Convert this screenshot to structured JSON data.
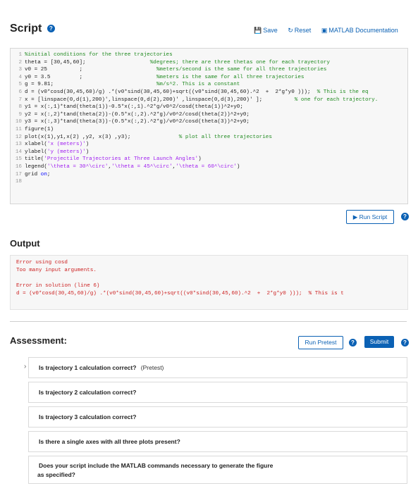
{
  "header": {
    "title": "Script",
    "help_glyph": "?",
    "save_label": "Save",
    "reset_label": "Reset",
    "docs_label": "MATLAB Documentation"
  },
  "editor": {
    "line_numbers": [
      "1",
      "2",
      "3",
      "4",
      "5",
      "6",
      "7",
      "8",
      "9",
      "10",
      "11",
      "12",
      "13",
      "14",
      "15",
      "16",
      "17",
      "18"
    ],
    "lines": [
      [
        {
          "t": "%initial conditions for the three trajectories",
          "c": "cm"
        }
      ],
      [
        {
          "t": "theta = [30,45,60];                    ",
          "c": ""
        },
        {
          "t": "%degrees; there are three thetas one for each trayectory",
          "c": "cm"
        }
      ],
      [
        {
          "t": "v0 = 25          ;                       ",
          "c": ""
        },
        {
          "t": "%meters/second is the same for all three trajectories",
          "c": "cm"
        }
      ],
      [
        {
          "t": "y0 = 3.5         ;                       ",
          "c": ""
        },
        {
          "t": "%meters is the same for all three trajectories",
          "c": "cm"
        }
      ],
      [
        {
          "t": "g = 9.81;                                ",
          "c": ""
        },
        {
          "t": "%m/s^2. This is a constant",
          "c": "cm"
        }
      ],
      [
        {
          "t": "d = (v0*cosd(30,45,60)/g) .*(v0*sind(30,45,60)+sqrt((v0*sind(30,45,60).^2  +  2*g*y0 )));  ",
          "c": ""
        },
        {
          "t": "% This is the eq",
          "c": "cm"
        }
      ],
      [
        {
          "t": "x = [linspace(0,d(1),200)',linspace(0,d(2),200)' ,linspace(0,d(3),200)' ];          ",
          "c": ""
        },
        {
          "t": "% one for each trajectory.",
          "c": "cm"
        }
      ],
      [
        {
          "t": "y1 = x(:,1)*tand(theta(1))-0.5*x(:,1).^2*g/v0^2/cosd(theta(1))^2+y0;",
          "c": ""
        }
      ],
      [
        {
          "t": "y2 = x(:,2)*tand(theta(2))-(0.5*x(:,2).^2*g)/v0^2/cosd(theta(2))^2+y0;",
          "c": ""
        }
      ],
      [
        {
          "t": "y3 = x(:,3)*tand(theta(3))-(0.5*x(:,2).^2*g)/v0^2/cosd(theta(3))^2+y0;",
          "c": ""
        }
      ],
      [
        {
          "t": "figure(1)",
          "c": ""
        }
      ],
      [
        {
          "t": "plot(x(1),y1,x(2) ,y2, x(3) ,y3);               ",
          "c": ""
        },
        {
          "t": "% plot all three trajectories",
          "c": "cm"
        }
      ],
      [
        {
          "t": "xlabel(",
          "c": ""
        },
        {
          "t": "'x (meters)'",
          "c": "str"
        },
        {
          "t": ")",
          "c": ""
        }
      ],
      [
        {
          "t": "ylabel(",
          "c": ""
        },
        {
          "t": "'y (meters)'",
          "c": "str"
        },
        {
          "t": ")",
          "c": ""
        }
      ],
      [
        {
          "t": "title(",
          "c": ""
        },
        {
          "t": "'Projectile Trajectories at Three Launch Angles'",
          "c": "str"
        },
        {
          "t": ")",
          "c": ""
        }
      ],
      [
        {
          "t": "legend(",
          "c": ""
        },
        {
          "t": "'\\theta = 30^\\circ'",
          "c": "str"
        },
        {
          "t": ",",
          "c": ""
        },
        {
          "t": "'\\theta = 45^\\circ'",
          "c": "str"
        },
        {
          "t": ",",
          "c": ""
        },
        {
          "t": "'\\theta = 60^\\circ'",
          "c": "str"
        },
        {
          "t": ")",
          "c": ""
        }
      ],
      [
        {
          "t": "grid ",
          "c": ""
        },
        {
          "t": "on",
          "c": "kw"
        },
        {
          "t": ";",
          "c": ""
        }
      ],
      [
        {
          "t": "",
          "c": ""
        }
      ]
    ]
  },
  "run_label": "Run Script",
  "output": {
    "title": "Output",
    "lines": [
      "Error using cosd",
      "Too many input arguments.",
      "",
      "Error in solution (line 6)",
      "d = (v0*cosd(30,45,60)/g) .*(v0*sind(30,45,60)+sqrt((v0*sind(30,45,60).^2  +  2*g*y0 )));  % This is t"
    ]
  },
  "assessment": {
    "title": "Assessment:",
    "run_pretest_label": "Run Pretest",
    "submit_label": "Submit",
    "questions": [
      {
        "text": "Is trajectory 1 calculation correct?",
        "suffix": "(Pretest)"
      },
      {
        "text": "Is trajectory 2 calculation correct?",
        "suffix": ""
      },
      {
        "text": "Is trajectory 3 calculation correct?",
        "suffix": ""
      },
      {
        "text": "Is there a single axes with all three plots present?",
        "suffix": ""
      },
      {
        "text": "Does your script include the MATLAB commands necessary to generate the figure",
        "text2": "as specified?",
        "suffix": ""
      }
    ]
  },
  "colors": {
    "accent": "#0b61b4",
    "error": "#cc2222",
    "comment": "#228b22",
    "string": "#a020f0"
  },
  "icons": [
    "help-icon",
    "save-icon",
    "reset-icon",
    "documentation-icon",
    "run-icon",
    "chevron-right-icon"
  ]
}
